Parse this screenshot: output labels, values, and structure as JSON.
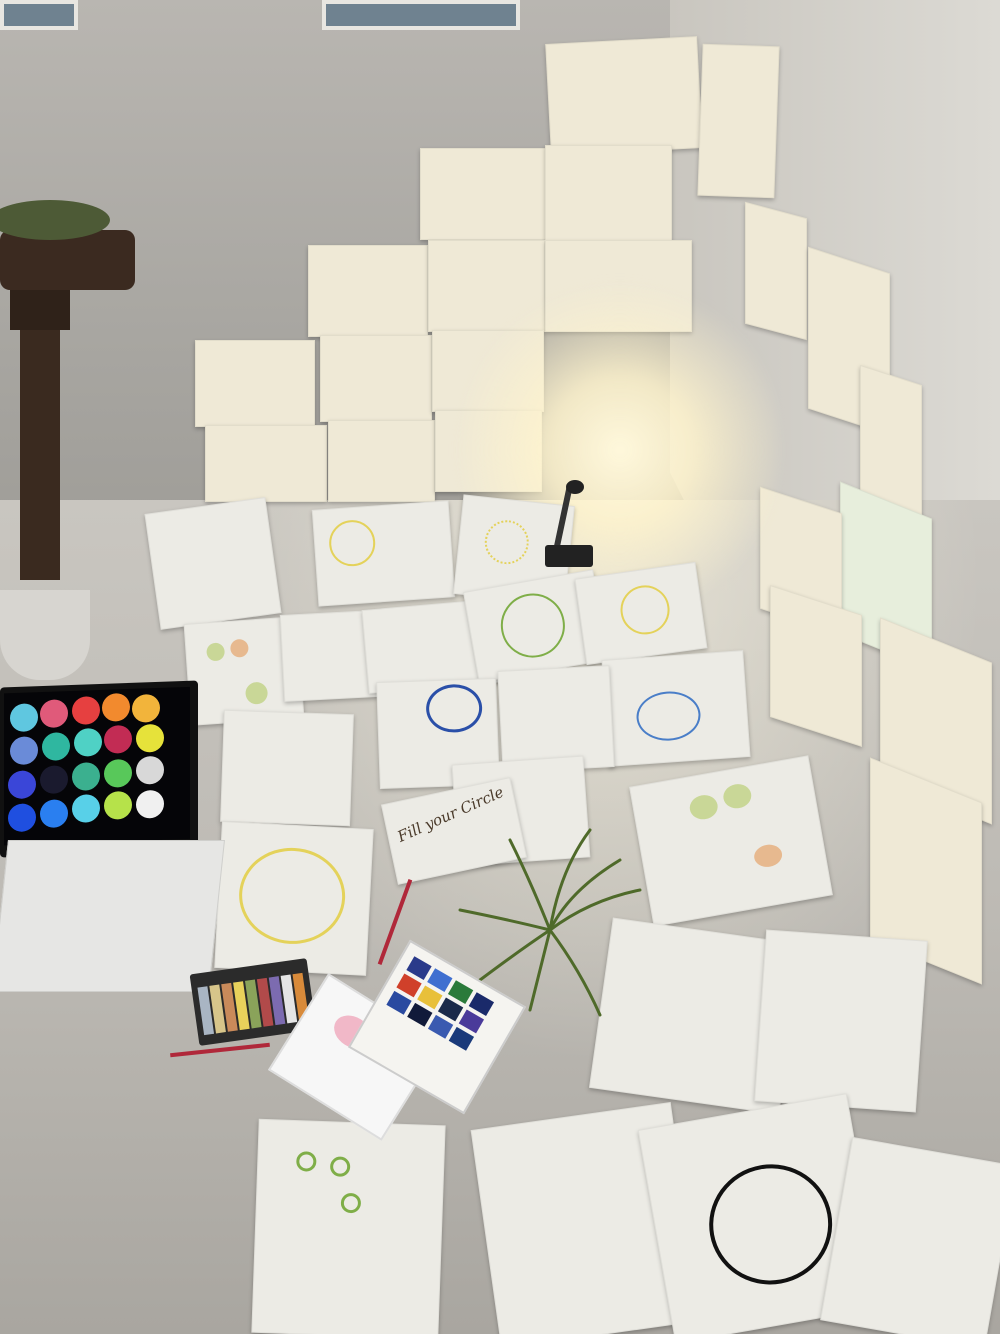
{
  "scene": {
    "description_free": true,
    "note": {
      "text": "Fill your Circle"
    }
  },
  "colors": {
    "wall": "#b9b6b1",
    "paper": "#ecebe5",
    "lamp_glow": "#fff4cd",
    "circle_blue": "#2a4fa8",
    "circle_black": "#111111",
    "circle_yellow": "#e4d25a",
    "circle_green": "#7fae48"
  },
  "icons": [
    "desk-lamp-icon",
    "laptop-icon",
    "air-plant-icon",
    "pastel-box-icon",
    "watercolor-palette-icon"
  ]
}
